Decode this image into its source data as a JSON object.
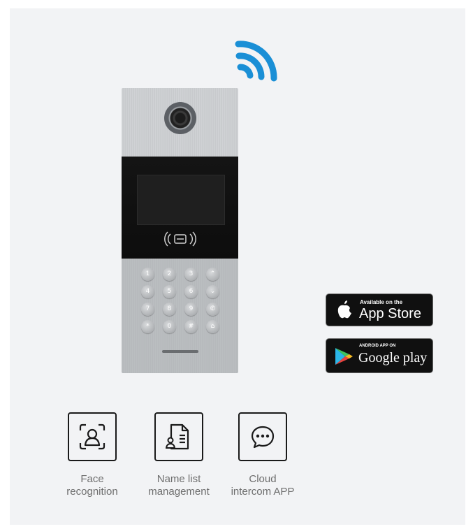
{
  "app_store": {
    "small_text": "Available on the",
    "big_text": "App Store",
    "icon": "apple-icon"
  },
  "google_play": {
    "small_text": "ANDROID APP ON",
    "big_text": "Google play",
    "icon": "google-play-icon"
  },
  "keypad": {
    "keys": [
      "1",
      "2",
      "3",
      "⌃",
      "4",
      "5",
      "6",
      "⌄",
      "7",
      "8",
      "9",
      "✆",
      "*",
      "0",
      "#",
      "⌂"
    ]
  },
  "features": [
    {
      "icon": "face-recognition-icon",
      "label": "Face\nrecognition"
    },
    {
      "icon": "name-list-icon",
      "label": "Name list\nmanagement"
    },
    {
      "icon": "chat-bubble-icon",
      "label": "Cloud\nintercom APP"
    }
  ],
  "colors": {
    "wifi": "#1a8fd6",
    "panel_bg": "#f2f3f5",
    "label_text": "#6e6e6e"
  }
}
